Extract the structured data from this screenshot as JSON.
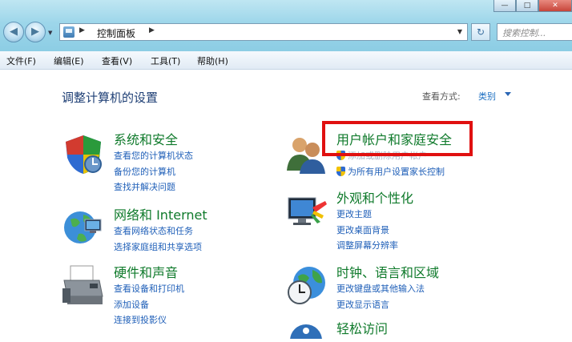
{
  "window": {
    "controls": [
      "—",
      "□",
      "✕"
    ]
  },
  "address_bar": {
    "breadcrumb": "控制面板",
    "search_placeholder": "搜索控制..."
  },
  "menu": [
    "文件(F)",
    "编辑(E)",
    "查看(V)",
    "工具(T)",
    "帮助(H)"
  ],
  "content": {
    "heading": "调整计算机的设置",
    "view_by_label": "查看方式:",
    "view_by_value": "类别"
  },
  "categories": [
    {
      "title": "系统和安全",
      "icon": "system-security-shield-icon",
      "links": [
        "查看您的计算机状态",
        "备份您的计算机",
        "查找并解决问题"
      ]
    },
    {
      "title": "网络和 Internet",
      "icon": "network-globe-icon",
      "links": [
        "查看网络状态和任务",
        "选择家庭组和共享选项"
      ]
    },
    {
      "title": "硬件和声音",
      "icon": "printer-icon",
      "links": [
        "查看设备和打印机",
        "添加设备",
        "连接到投影仪"
      ]
    },
    {
      "title": "用户帐户和家庭安全",
      "icon": "users-icon",
      "links": [
        "添加或删除用户帐户",
        "为所有用户设置家长控制"
      ],
      "highlighted": true
    },
    {
      "title": "外观和个性化",
      "icon": "display-paint-icon",
      "links": [
        "更改主题",
        "更改桌面背景",
        "调整屏幕分辨率"
      ]
    },
    {
      "title": "时钟、语言和区域",
      "icon": "clock-globe-icon",
      "links": [
        "更改键盘或其他输入法",
        "更改显示语言"
      ]
    },
    {
      "title": "轻松访问",
      "icon": "ease-of-access-icon",
      "links": []
    }
  ],
  "colors": {
    "category_title": "#0f7a2b",
    "link": "#1f5fb8",
    "highlight_box": "#e01010"
  }
}
